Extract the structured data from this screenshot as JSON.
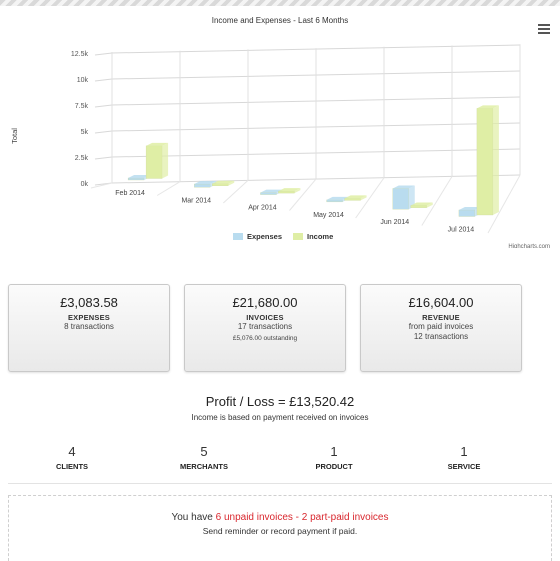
{
  "chart_data": {
    "type": "bar",
    "title": "Income and Expenses - Last 6 Months",
    "ylabel": "Total",
    "categories": [
      "Feb 2014",
      "Mar 2014",
      "Apr 2014",
      "May 2014",
      "Jun 2014",
      "Jul 2014"
    ],
    "y_ticks": [
      "0k",
      "2.5k",
      "5k",
      "7.5k",
      "10k",
      "12.5k"
    ],
    "ylim": [
      0,
      12500
    ],
    "grid": true,
    "legend_placement": "bottom-center",
    "credits": "Highcharts.com",
    "series": [
      {
        "name": "Expenses",
        "color": "#b9dcef",
        "values": [
          80,
          300,
          150,
          80,
          1900,
          600
        ]
      },
      {
        "name": "Income",
        "color": "#dfeea5",
        "values": [
          3000,
          150,
          100,
          60,
          200,
          9800
        ]
      }
    ]
  },
  "menu_icon": "hamburger-menu-icon",
  "cards": [
    {
      "amount": "£3,083.58",
      "label": "EXPENSES",
      "sub1": "8 transactions"
    },
    {
      "amount": "£21,680.00",
      "label": "INVOICES",
      "sub1": "17 transactions",
      "small": "£5,076.00 outstanding"
    },
    {
      "amount": "£16,604.00",
      "label": "REVENUE",
      "sub1": "from paid invoices",
      "sub2": "12 transactions"
    }
  ],
  "profit": {
    "text": "Profit / Loss = £13,520.42",
    "note": "Income is based on payment received on invoices"
  },
  "stats": [
    {
      "value": "4",
      "label": "CLIENTS"
    },
    {
      "value": "5",
      "label": "MERCHANTS"
    },
    {
      "value": "1",
      "label": "PRODUCT"
    },
    {
      "value": "1",
      "label": "SERVICE"
    }
  ],
  "notice": {
    "prefix": "You have ",
    "unpaid_link": "6 unpaid invoices",
    "separator": " - ",
    "partpaid_link": "2 part-paid invoices",
    "line2": "Send reminder or record payment if paid.",
    "link_color": "#d9272e"
  }
}
